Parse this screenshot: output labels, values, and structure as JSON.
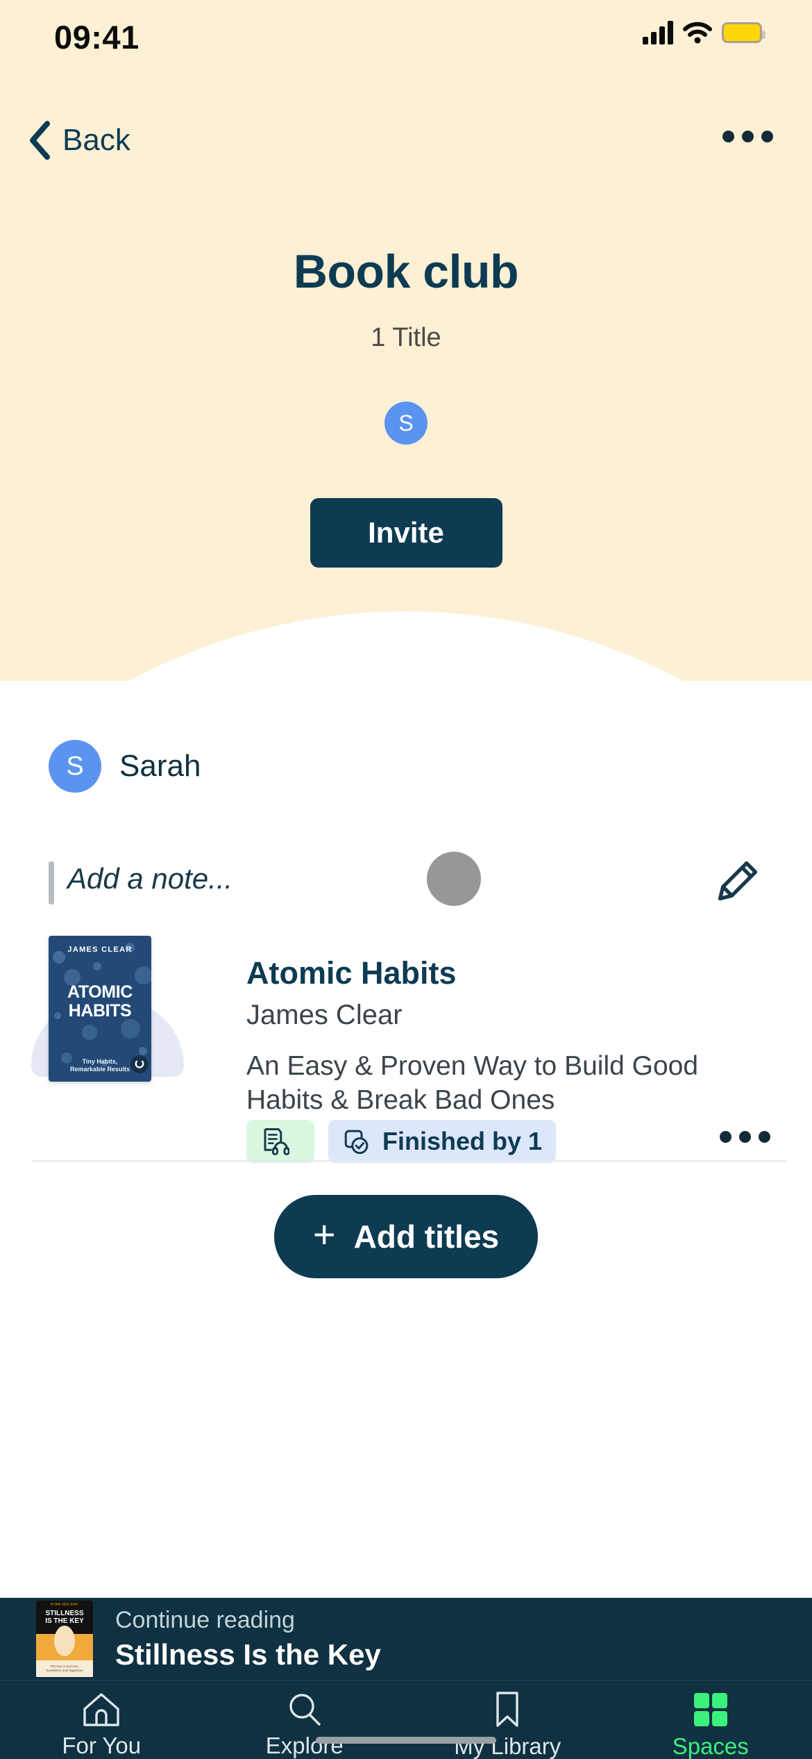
{
  "status_bar": {
    "time": "09:41",
    "signal_icon": "cellular-bars-icon",
    "wifi_icon": "wifi-icon",
    "battery_icon": "battery-low-power-icon",
    "battery_color": "#ffd60a"
  },
  "nav": {
    "back_label": "Back",
    "back_icon": "chevron-left-icon",
    "overflow_icon": "more-horizontal-icon"
  },
  "header": {
    "title": "Book club",
    "subtitle": "1 Title",
    "members": [
      {
        "initial": "S",
        "color": "#5b94f0"
      }
    ],
    "invite_label": "Invite",
    "background_color": "#fdf0d5",
    "accent_color": "#0d3b52"
  },
  "owner": {
    "initial": "S",
    "name": "Sarah"
  },
  "note": {
    "placeholder": "Add a note...",
    "edit_icon": "pencil-icon"
  },
  "book": {
    "title": "Atomic Habits",
    "author": "James Clear",
    "description": "An Easy & Proven Way to Build Good Habits & Break Bad Ones",
    "cover": {
      "author_line": "JAMES CLEAR",
      "title_line_1": "ATOMIC",
      "title_line_2": "HABITS",
      "tagline_1": "Tiny Habits,",
      "tagline_2": "Remarkable Results"
    },
    "badges": [
      {
        "icon": "audiobook-icon",
        "label": "",
        "color": "#d8f8e2"
      },
      {
        "icon": "finished-book-check-icon",
        "label": "Finished by 1",
        "color": "#dce7fb"
      }
    ],
    "overflow_icon": "more-horizontal-icon"
  },
  "add_titles": {
    "label": "Add titles",
    "icon": "plus-icon"
  },
  "player": {
    "kicker": "Continue reading",
    "title": "Stillness Is the Key",
    "cover": {
      "author_line": "RYAN HOLIDAY",
      "title_line_1": "STILLNESS",
      "title_line_2": "IS THE KEY",
      "sub_line_1": "The Key to Success,",
      "sub_line_2": "Excellence and Happiness"
    }
  },
  "tabs": [
    {
      "label": "For You",
      "icon": "home-icon",
      "active": false
    },
    {
      "label": "Explore",
      "icon": "search-icon",
      "active": false
    },
    {
      "label": "My Library",
      "icon": "bookmark-icon",
      "active": false
    },
    {
      "label": "Spaces",
      "icon": "spaces-grid-icon",
      "active": true
    }
  ],
  "tab_active_color": "#3cf07d"
}
